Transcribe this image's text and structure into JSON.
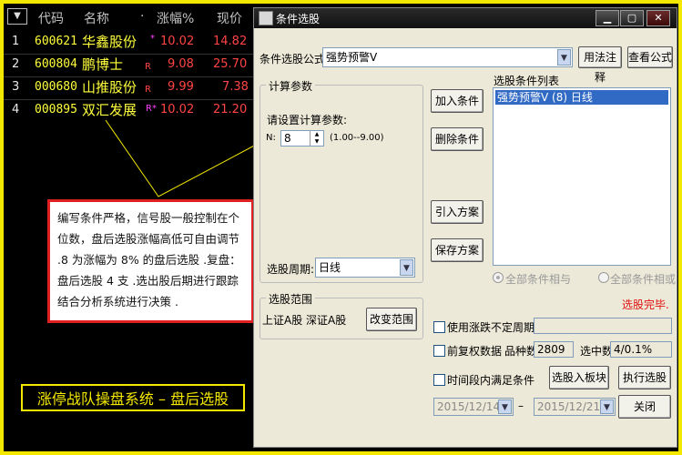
{
  "stock_list": {
    "menu_icon": "▼",
    "headers": {
      "code": "代码",
      "name": "名称",
      "dot": "·",
      "change": "涨幅%",
      "price": "现价"
    },
    "rows": [
      {
        "index": "1",
        "code": "600621",
        "name": "华鑫股份",
        "flag": "*",
        "change": "10.02",
        "price": "14.82"
      },
      {
        "index": "2",
        "code": "600804",
        "name": "鹏博士",
        "flag": "R",
        "change": "9.08",
        "price": "25.70"
      },
      {
        "index": "3",
        "code": "000680",
        "name": "山推股份",
        "flag": "R",
        "change": "9.99",
        "price": "7.38"
      },
      {
        "index": "4",
        "code": "000895",
        "name": "双汇发展",
        "flag": "R*",
        "change": "10.02",
        "price": "21.20"
      }
    ]
  },
  "callout": {
    "text": "编写条件严格，信号股一般控制在个位数，盘后选股涨幅高低可自由调节 .8 为涨幅为 8% 的盘后选股 .复盘：盘后选股 4 支 .选出股后期进行跟踪结合分析系统进行决策 ."
  },
  "banner": {
    "text": "涨停战队操盘系统 – 盘后选股"
  },
  "dialog": {
    "title": "条件选股",
    "window_buttons": {
      "minimize": "▁",
      "maximize": "▢",
      "close": "✕"
    },
    "formula_label": "条件选股公式",
    "formula_value": "强势预警V",
    "btn_formula_note": "用法注释",
    "btn_view_formula": "查看公式",
    "calc_group_title": "计算参数",
    "calc_prompt": "请设置计算参数:",
    "param_name": "N:",
    "param_value": "8",
    "param_range": "(1.00--9.00)",
    "btn_add": "加入条件",
    "btn_delete": "删除条件",
    "btn_import": "引入方案",
    "btn_save": "保存方案",
    "cond_list_title": "选股条件列表",
    "cond_items": [
      "强势预警V (8) 日线"
    ],
    "period_label": "选股周期:",
    "period_value": "日线",
    "radio_and": "全部条件相与",
    "radio_or": "全部条件相或",
    "status": "选股完毕.",
    "range_group_title": "选股范围",
    "range_value": "上证A股 深证A股",
    "btn_change_range": "改变范围",
    "chk_unstable": "使用涨跌不定周期",
    "chk_adjust": "前复权数据",
    "count_label": "品种数",
    "count_value": "2809",
    "selected_label": "选中数",
    "selected_value": "4/0.1%",
    "chk_period": "时间段内满足条件",
    "btn_add_block": "选股入板块",
    "btn_execute": "执行选股",
    "date_from": "2015/12/14",
    "date_sep": "–",
    "date_to": "2015/12/21",
    "btn_close": "关闭"
  }
}
